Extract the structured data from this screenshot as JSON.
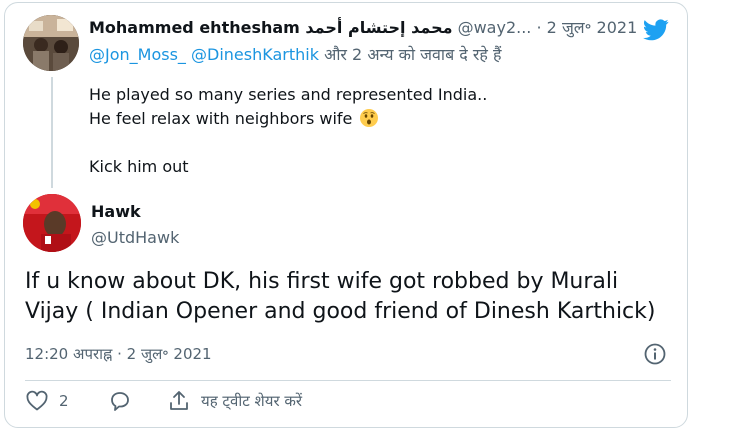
{
  "tweet1": {
    "author_name": "Mohammed ehthesham محمد إحتشام أحمد",
    "handle": "@way2...",
    "separator": "·",
    "date": "2 जुल॰ 2021",
    "replying_mention1": "@Jon_Moss_",
    "replying_mention2": "@DineshKarthik",
    "replying_rest": "और 2 अन्य को जवाब दे रहे हैं",
    "lines": [
      "He played so many series and represented India..",
      "He feel relax with neighbors wife",
      "",
      "Kick him out"
    ]
  },
  "tweet2": {
    "author_name": "Hawk",
    "handle": "@UtdHawk",
    "text": "If u know about DK, his first wife got robbed by Murali Vijay ( Indian Opener and good friend of Dinesh Karthick)",
    "timestamp": "12:20 अपराह्न · 2 जुल॰ 2021",
    "like_count": "2",
    "share_label": "यह ट्वीट शेयर करें"
  },
  "icons": {
    "brand": "twitter-bird-icon",
    "info": "info-icon",
    "like": "heart-icon",
    "reply": "reply-bubble-icon",
    "share": "share-icon",
    "emoji": "astonished-face-emoji"
  },
  "colors": {
    "brand_blue": "#1da1f2",
    "mention_blue": "#1b95e0",
    "secondary_text": "#536471",
    "border": "#cfd9de"
  }
}
